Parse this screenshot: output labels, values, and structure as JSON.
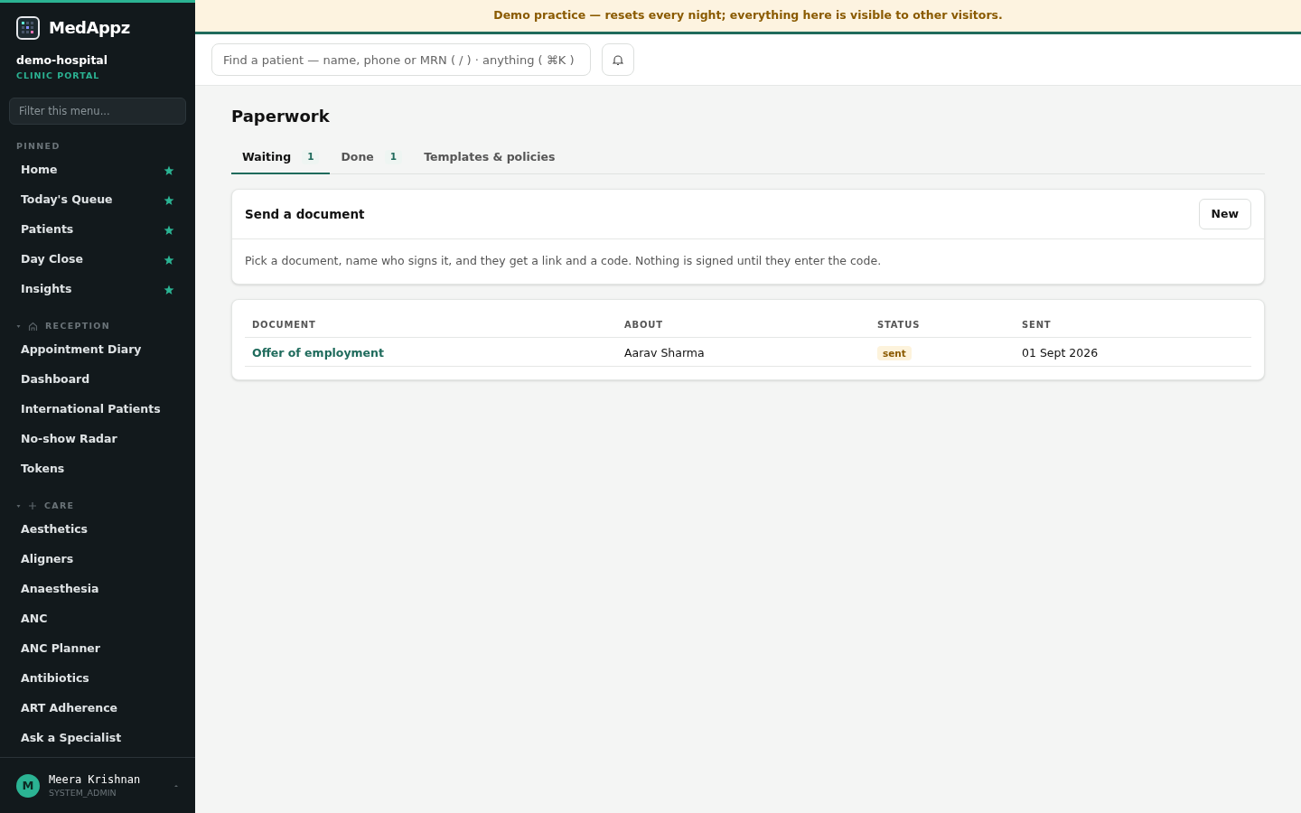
{
  "sidebar": {
    "logo": "MedAppz",
    "org": "demo-hospital",
    "org_subtitle": "CLINIC PORTAL",
    "filter": {
      "placeholder": "Filter this menu..."
    },
    "sections": [
      {
        "label": "PINNED",
        "items": [
          {
            "label": "Home",
            "starred": true
          },
          {
            "label": "Today's Queue",
            "starred": true
          },
          {
            "label": "Patients",
            "starred": true
          },
          {
            "label": "Day Close",
            "starred": true
          },
          {
            "label": "Insights",
            "starred": true
          }
        ]
      },
      {
        "label": "RECEPTION",
        "expanded": true,
        "items": [
          {
            "label": "Appointment Diary"
          },
          {
            "label": "Dashboard"
          },
          {
            "label": "International Patients"
          },
          {
            "label": "No-show Radar"
          },
          {
            "label": "Tokens"
          }
        ]
      },
      {
        "label": "CARE",
        "expanded": true,
        "items": [
          {
            "label": "Aesthetics"
          },
          {
            "label": "Aligners"
          },
          {
            "label": "Anaesthesia"
          },
          {
            "label": "ANC"
          },
          {
            "label": "ANC Planner"
          },
          {
            "label": "Antibiotics"
          },
          {
            "label": "ART Adherence"
          },
          {
            "label": "Ask a Specialist"
          }
        ]
      }
    ],
    "user": {
      "initial": "M",
      "name": "Meera Krishnan",
      "role": "SYSTEM_ADMIN"
    }
  },
  "banner": "Demo practice — resets every night; everything here is visible to other visitors.",
  "search": {
    "placeholder": "Find a patient — name, phone or MRN ( / ) · anything ( ⌘K )"
  },
  "page_title": "Paperwork",
  "tabs": [
    {
      "label": "Waiting",
      "count": "1",
      "selected": true
    },
    {
      "label": "Done",
      "count": "1",
      "selected": false
    },
    {
      "label": "Templates & policies",
      "selected": false
    }
  ],
  "send_card": {
    "title": "Send a document",
    "button": "New",
    "description": "Pick a document, name who signs it, and they get a link and a code. Nothing is signed until they enter the code."
  },
  "table": {
    "columns": [
      "DOCUMENT",
      "ABOUT",
      "STATUS",
      "SENT"
    ],
    "rows": [
      {
        "document": "Offer of employment",
        "about": "Aarav Sharma",
        "status": "sent",
        "sent": "01 Sept 2026"
      }
    ]
  }
}
